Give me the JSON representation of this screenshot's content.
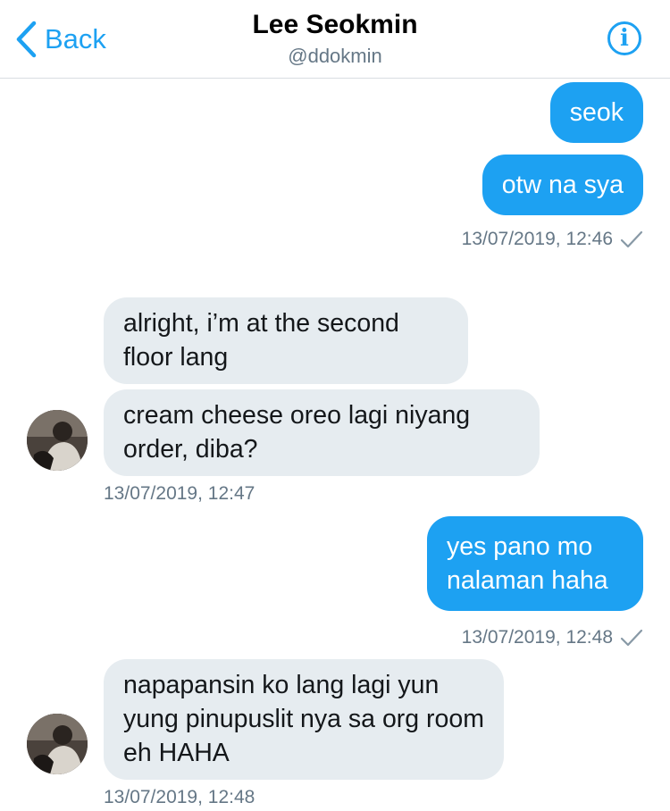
{
  "header": {
    "back_label": "Back",
    "name": "Lee Seokmin",
    "handle": "@ddokmin",
    "info_glyph": "i"
  },
  "messages": [
    {
      "direction": "sent",
      "text": "seok"
    },
    {
      "direction": "sent",
      "text": "otw na sya"
    },
    {
      "direction": "sent_timestamp",
      "text": "13/07/2019, 12:46"
    },
    {
      "direction": "received",
      "text": "alright, i’m at the second floor lang"
    },
    {
      "direction": "received",
      "text": "cream cheese oreo lagi niyang order, diba?"
    },
    {
      "direction": "received_timestamp",
      "text": "13/07/2019, 12:47"
    },
    {
      "direction": "sent",
      "text": "yes pano mo nalaman haha"
    },
    {
      "direction": "sent_timestamp",
      "text": "13/07/2019, 12:48"
    },
    {
      "direction": "received",
      "text": "napapansin ko lang lagi yun yung pinupuslit nya sa org room eh HAHA"
    },
    {
      "direction": "received_timestamp",
      "text": "13/07/2019, 12:48"
    }
  ],
  "icons": {
    "back": "chevron-left-icon",
    "info": "info-icon",
    "read_receipt": "checkmark-icon",
    "avatar": "user-avatar"
  },
  "colors": {
    "accent": "#1da1f2",
    "received_bubble": "#e6ecf0",
    "secondary_text": "#657786"
  }
}
